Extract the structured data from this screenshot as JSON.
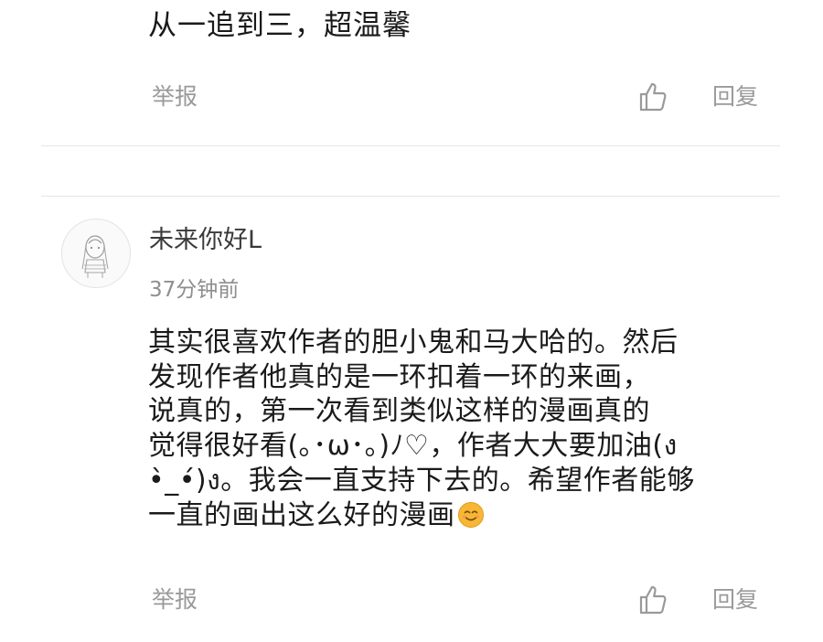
{
  "first_comment": {
    "text": "从一追到三，超温馨",
    "actions": {
      "report_label": "举报",
      "reply_label": "回复"
    }
  },
  "second_comment": {
    "username": "未来你好L",
    "timestamp": "37分钟前",
    "body": "其实很喜欢作者的胆小鬼和马大哈的。然后\n发现作者他真的是一环扣着一环的来画，\n说真的，第一次看到类似这样的漫画真的\n觉得很好看(｡･ω･｡)ﾉ♡，作者大大要加油(ง\n•̀_•́)ง。我会一直支持下去的。希望作者能够\n一直的画出这么好的漫画",
    "emoji": "smiling-face-emoji",
    "actions": {
      "report_label": "举报",
      "reply_label": "回复"
    }
  },
  "colors": {
    "text_primary": "#1a1a1a",
    "text_secondary": "#9a9a9a",
    "divider": "#e6e6e6",
    "emoji_fill": "#f7b733"
  },
  "icons": {
    "like": "thumbs-up-icon"
  }
}
